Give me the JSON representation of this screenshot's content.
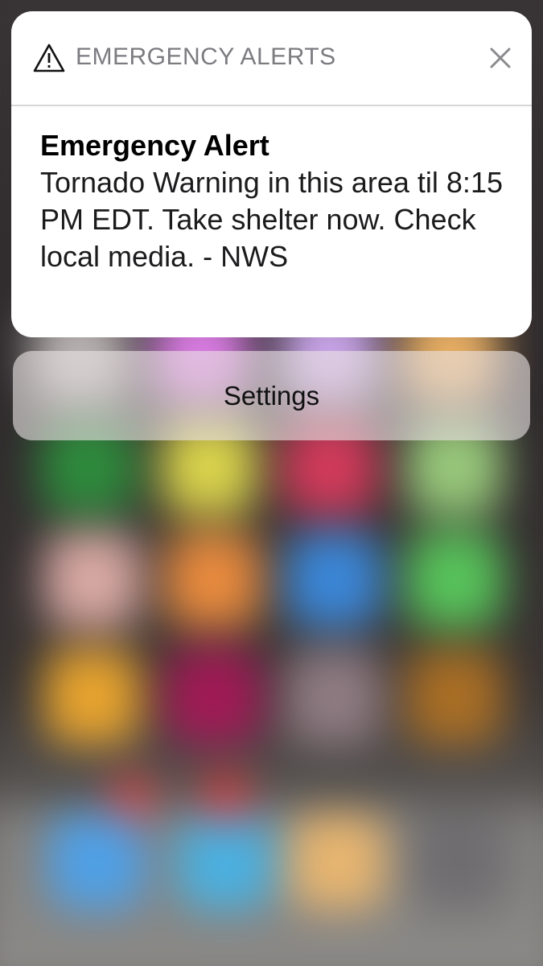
{
  "notification": {
    "app_name": "EMERGENCY ALERTS",
    "icon": "warning-triangle-icon",
    "close_icon": "close-icon",
    "title": "Emergency Alert",
    "message": "Tornado Warning in this area til 8:15 PM EDT. Take shelter now. Check local media. - NWS"
  },
  "actions": {
    "settings_label": "Settings"
  },
  "colors": {
    "card_background": "#ffffff",
    "header_text": "#7b7b80",
    "divider": "#d7d7da",
    "action_background": "#e8e2e2"
  }
}
